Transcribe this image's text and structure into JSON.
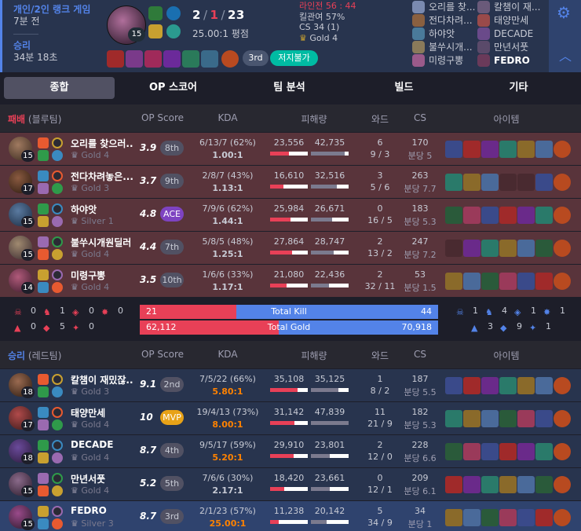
{
  "header": {
    "mode": "개인/2인 랭크 게임",
    "ago": "7분 전",
    "result": "승리",
    "duration": "34분 18초",
    "champion_level": "15",
    "kda": {
      "k": "2",
      "d": "1",
      "a": "23"
    },
    "kda_ratio": "25.00:1 평점",
    "stats": {
      "laning": "라인전 56 : 44",
      "kill_participation": "킬관여 57%",
      "cs": "CS 34 (1)",
      "tier": "Gold 4"
    },
    "badges": {
      "rank": "3rd",
      "multikill": "저지불가"
    },
    "players": [
      {
        "name": "오리를 찾..."
      },
      {
        "name": "칼챔이 재..."
      },
      {
        "name": "전다차려..."
      },
      {
        "name": "태양만세"
      },
      {
        "name": "하야앗"
      },
      {
        "name": "DECADE"
      },
      {
        "name": "불쑤시개..."
      },
      {
        "name": "만년서풋"
      },
      {
        "name": "미령구뽕"
      },
      {
        "name": "FEDRO"
      }
    ],
    "me_name": "FEDRO",
    "colors": {
      "accent": "#5383e8",
      "loss": "#e84057",
      "win_bg": "#28344e",
      "loss_bg": "#59343b"
    }
  },
  "tabs": [
    "종합",
    "OP 스코어",
    "팀 분석",
    "빌드",
    "기타"
  ],
  "columns": {
    "op": "OP Score",
    "kda": "KDA",
    "dmg": "피해량",
    "ward": "와드",
    "cs": "CS",
    "items": "아이템"
  },
  "team_loss": {
    "result": "패배",
    "side": "(블루팀)",
    "players": [
      {
        "lvl": "15",
        "name": "오리를 찾으러...",
        "tier": "Gold 4",
        "op": "3.9",
        "rank": "8th",
        "kda": "6/13/7 (62%)",
        "ratio": "1.00:1",
        "dealt": "23,556",
        "taken": "42,735",
        "dealt_v": 23556,
        "taken_v": 42735,
        "ward1": "6",
        "ward2": "9 / 3",
        "cs": "170",
        "cspm": "분당 5"
      },
      {
        "lvl": "17",
        "name": "전다차려놓은...",
        "tier": "Gold 3",
        "op": "3.7",
        "rank": "9th",
        "kda": "2/8/7 (43%)",
        "ratio": "1.13:1",
        "dealt": "16,610",
        "taken": "32,516",
        "dealt_v": 16610,
        "taken_v": 32516,
        "ward1": "3",
        "ward2": "5 / 6",
        "cs": "263",
        "cspm": "분당 7.7"
      },
      {
        "lvl": "15",
        "name": "하야앗",
        "tier": "Silver 1",
        "op": "4.8",
        "rank": "ACE",
        "kda": "7/9/6 (62%)",
        "ratio": "1.44:1",
        "dealt": "25,984",
        "taken": "26,671",
        "dealt_v": 25984,
        "taken_v": 26671,
        "ward1": "0",
        "ward2": "16 / 5",
        "cs": "183",
        "cspm": "분당 5.3"
      },
      {
        "lvl": "15",
        "name": "불쑤시개원딜러",
        "tier": "Gold 4",
        "op": "4.4",
        "rank": "7th",
        "kda": "5/8/5 (48%)",
        "ratio": "1.25:1",
        "dealt": "27,864",
        "taken": "28,747",
        "dealt_v": 27864,
        "taken_v": 28747,
        "ward1": "2",
        "ward2": "13 / 2",
        "cs": "247",
        "cspm": "분당 7.2"
      },
      {
        "lvl": "14",
        "name": "미령구뽕",
        "tier": "Gold 4",
        "op": "3.5",
        "rank": "10th",
        "kda": "1/6/6 (33%)",
        "ratio": "1.17:1",
        "dealt": "21,080",
        "taken": "22,436",
        "dealt_v": 21080,
        "taken_v": 22436,
        "ward1": "2",
        "ward2": "32 / 11",
        "cs": "53",
        "cspm": "분당 1.5"
      }
    ]
  },
  "team_win": {
    "result": "승리",
    "side": "(레드팀)",
    "players": [
      {
        "lvl": "18",
        "name": "칼챔이 재밌잖...",
        "tier": "Gold 3",
        "op": "9.1",
        "rank": "2nd",
        "kda": "7/5/22 (66%)",
        "ratio": "5.80:1",
        "dealt": "35,108",
        "taken": "35,125",
        "dealt_v": 35108,
        "taken_v": 35125,
        "ward1": "1",
        "ward2": "8 / 2",
        "cs": "187",
        "cspm": "분당 5.5"
      },
      {
        "lvl": "17",
        "name": "태양만세",
        "tier": "Gold 4",
        "op": "10",
        "rank": "MVP",
        "kda": "19/4/13 (73%)",
        "ratio": "8.00:1",
        "dealt": "31,142",
        "taken": "47,839",
        "dealt_v": 31142,
        "taken_v": 47839,
        "ward1": "11",
        "ward2": "21 / 9",
        "cs": "182",
        "cspm": "분당 5.3"
      },
      {
        "lvl": "18",
        "name": "DECADE",
        "tier": "Gold 4",
        "op": "8.7",
        "rank": "4th",
        "kda": "9/5/17 (59%)",
        "ratio": "5.20:1",
        "dealt": "29,910",
        "taken": "23,801",
        "dealt_v": 29910,
        "taken_v": 23801,
        "ward1": "2",
        "ward2": "12 / 0",
        "cs": "228",
        "cspm": "분당 6.6"
      },
      {
        "lvl": "15",
        "name": "만년서풋",
        "tier": "Gold 4",
        "op": "5.2",
        "rank": "5th",
        "kda": "7/6/6 (30%)",
        "ratio": "2.17:1",
        "dealt": "18,420",
        "taken": "23,661",
        "dealt_v": 18420,
        "taken_v": 23661,
        "ward1": "0",
        "ward2": "12 / 1",
        "cs": "209",
        "cspm": "분당 6.1"
      },
      {
        "lvl": "15",
        "name": "FEDRO",
        "tier": "Silver 3",
        "op": "8.7",
        "rank": "3rd",
        "kda": "2/1/23 (57%)",
        "ratio": "25.00:1",
        "dealt": "11,238",
        "taken": "20,142",
        "dealt_v": 11238,
        "taken_v": 20142,
        "ward1": "5",
        "ward2": "34 / 9",
        "cs": "34",
        "cspm": "분당 1"
      }
    ]
  },
  "summary": {
    "kill_label": "Total Kill",
    "kill_left": "21",
    "kill_right": "44",
    "kill_left_v": 21,
    "kill_right_v": 44,
    "gold_label": "Total Gold",
    "gold_left": "62,112",
    "gold_right": "70,918",
    "gold_left_v": 62112,
    "gold_right_v": 70918,
    "left_obj": [
      "0",
      "1",
      "0",
      "0",
      "0",
      "5",
      "0"
    ],
    "right_obj": [
      "1",
      "4",
      "1",
      "1",
      "3",
      "9",
      "1"
    ]
  }
}
